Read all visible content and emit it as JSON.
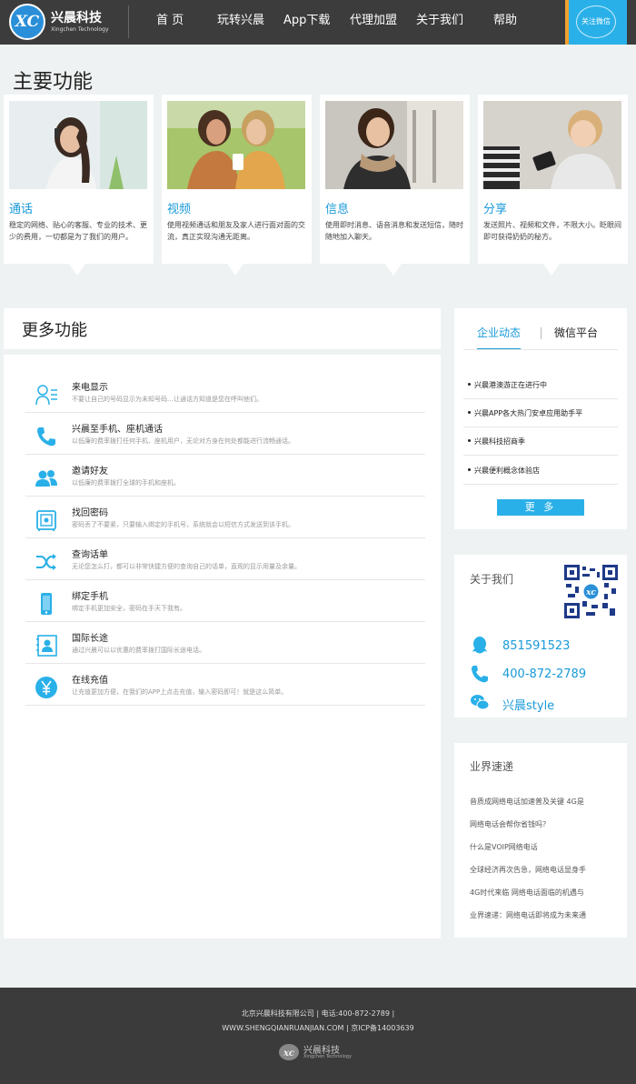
{
  "brand": {
    "cn": "兴晨科技",
    "en": "Xingchen Technology",
    "mark": "XC"
  },
  "nav": [
    {
      "label": "首  页"
    },
    {
      "label": "玩转兴晨"
    },
    {
      "label": "App下载"
    },
    {
      "label": "代理加盟"
    },
    {
      "label": "关于我们"
    },
    {
      "label": "帮助"
    }
  ],
  "wechat_btn": "关注微信",
  "main_title": "主要功能",
  "cards": [
    {
      "title": "通话",
      "desc": "稳定的网络、贴心的客服、专业的技术、更少的费用，一切都是为了我们的用户。"
    },
    {
      "title": "视频",
      "desc": "使用视频通话和朋友及家人进行面对面的交流，真正实现沟通无距离。"
    },
    {
      "title": "信息",
      "desc": "使用即时消息、语音消息和发送短信，随时随地加入聊天。"
    },
    {
      "title": "分享",
      "desc": "发送照片、视频和文件，不限大小。眨眼间即可获得奶奶的秘方。"
    }
  ],
  "more_title": "更多功能",
  "features": [
    {
      "title": "来电显示",
      "desc": "不要让自己的号码显示为未知号码…让通话方知道是您在呼叫他们。",
      "icon": "contact-card-icon"
    },
    {
      "title": "兴晨至手机、座机通话",
      "desc": "以低廉的费率拨打任何手机、座机用户，无论对方身在何处都能进行流畅通话。",
      "icon": "phone-icon"
    },
    {
      "title": "邀请好友",
      "desc": "以低廉的费率拨打全球的手机和座机。",
      "icon": "users-icon"
    },
    {
      "title": "找回密码",
      "desc": "密码丢了不要紧，只要输入绑定的手机号，系统就会以短信方式发送到该手机。",
      "icon": "safe-icon"
    },
    {
      "title": "查询话单",
      "desc": "无论您怎么打，都可以非常快捷方便的查询自己的话单，直观的显示用量及余量。",
      "icon": "shuffle-icon"
    },
    {
      "title": "绑定手机",
      "desc": "绑定手机更加安全，密码在手天下我有。",
      "icon": "mobile-icon"
    },
    {
      "title": "国际长途",
      "desc": "通过兴晨可以以优惠的费率拨打国际长途电话。",
      "icon": "portrait-icon"
    },
    {
      "title": "在线充值",
      "desc": "让充值更加方便，在我们的APP上点击充值，输入密码即可！就是这么简单。",
      "icon": "yen-icon"
    }
  ],
  "news_tabs": {
    "active": "企业动态",
    "inactive": "微信平台"
  },
  "news": [
    {
      "text": "兴晨港澳游正在进行中"
    },
    {
      "text": "兴晨APP各大热门安卓应用助手平"
    },
    {
      "text": "兴晨科技招商季"
    },
    {
      "text": "兴晨便利概念体验店"
    }
  ],
  "news_more": "更 多",
  "about": {
    "title": "关于我们",
    "qq": "851591523",
    "phone": "400-872-2789",
    "wechat": "兴晨style"
  },
  "industry": {
    "title": "业界速递",
    "items": [
      {
        "text": "音质成网络电话加速普及关键 4G是"
      },
      {
        "text": "网络电话会帮你省钱吗？"
      },
      {
        "text": "什么是VOIP网络电话"
      },
      {
        "text": "全球经济再次告急，网络电话显身手"
      },
      {
        "text": "4G时代来临 网络电话面临的机遇与"
      },
      {
        "text": "业界速递：网络电话即将成为未来通"
      }
    ]
  },
  "footer": {
    "line1": "北京兴晨科技有限公司  |  电话:400-872-2789  |",
    "line2": "WWW.SHENGQIANRUANJIAN.COM  |  京ICP备14003639",
    "logo_cn": "兴晨科技",
    "logo_en": "Xingchen Technology"
  },
  "colors": {
    "accent": "#1a9ad8",
    "button": "#2ab0e8",
    "header": "#3c3c3c",
    "wechat_border": "#f0a030"
  }
}
